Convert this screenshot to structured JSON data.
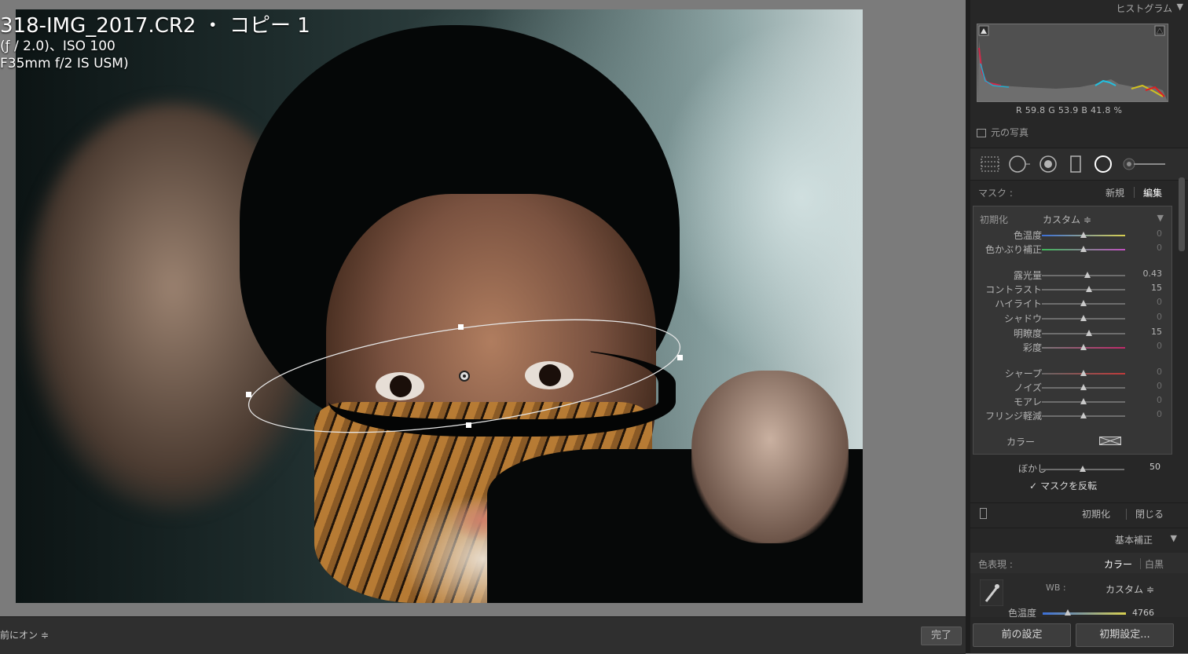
{
  "photo": {
    "filename_line": "318-IMG_2017.CR2 ・ コピー 1",
    "exposure_line": "(ƒ / 2.0)、ISO 100",
    "lens_line": "F35mm f/2 IS USM)"
  },
  "toolbar": {
    "left_label": "前にオン ≑",
    "done_label": "完了"
  },
  "histogram": {
    "title": "ヒストグラム",
    "rgb_readout": "R 59.8  G 53.9  B 41.8 %",
    "original_photo_label": "元の写真"
  },
  "mask": {
    "label": "マスク :",
    "new_label": "新規",
    "edit_label": "編集"
  },
  "adjust": {
    "preset_label": "初期化",
    "preset_value": "カスタム ≑",
    "sliders": [
      {
        "label": "色温度",
        "value": "0"
      },
      {
        "label": "色かぶり補正",
        "value": "0"
      },
      {
        "label": "露光量",
        "value": "0.43"
      },
      {
        "label": "コントラスト",
        "value": "15"
      },
      {
        "label": "ハイライト",
        "value": "0"
      },
      {
        "label": "シャドウ",
        "value": "0"
      },
      {
        "label": "明瞭度",
        "value": "15"
      },
      {
        "label": "彩度",
        "value": "0"
      },
      {
        "label": "シャープ",
        "value": "0"
      },
      {
        "label": "ノイズ",
        "value": "0"
      },
      {
        "label": "モアレ",
        "value": "0"
      },
      {
        "label": "フリンジ軽減",
        "value": "0"
      }
    ],
    "color_label": "カラー",
    "feather_label": "ぼかし",
    "feather_value": "50",
    "invert_label": "マスクを反転",
    "reset_label": "初期化",
    "close_label": "閉じる"
  },
  "basic": {
    "title": "基本補正",
    "treatment_label": "色表現 :",
    "color_option": "カラー",
    "bw_option": "白黒",
    "wb_label": "WB :",
    "wb_value": "カスタム ≑",
    "temp_label": "色温度",
    "temp_value": "4766"
  },
  "buttons": {
    "previous": "前の設定",
    "defaults": "初期設定..."
  },
  "colors": {
    "panel_bg": "#272727",
    "canvas_bg": "#7b7b7b",
    "toolbar_bg": "#2f2f2f"
  }
}
